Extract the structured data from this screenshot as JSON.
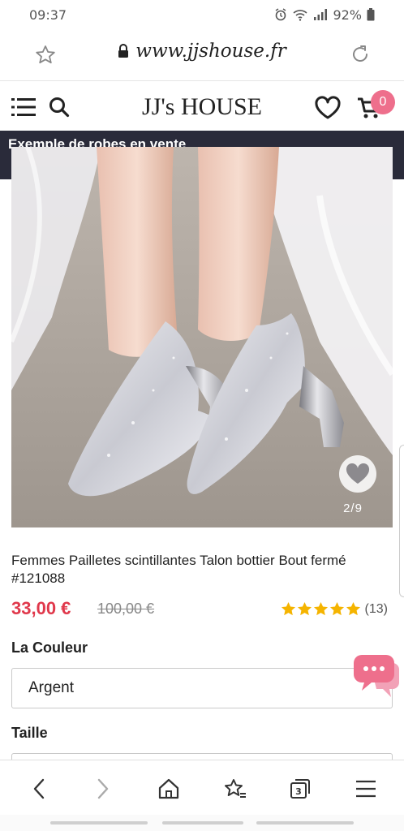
{
  "status_bar": {
    "time": "09:37",
    "battery": "92%"
  },
  "browser": {
    "url": "www.jjshouse.fr"
  },
  "header": {
    "brand": "JJ's HOUSE",
    "cart_count": "0"
  },
  "promo": {
    "text": "Exemple de robes en vente"
  },
  "gallery": {
    "counter": "2/9"
  },
  "product": {
    "title": "Femmes Pailletes scintillantes Talon bottier Bout fermé #121088",
    "price": "33,00 €",
    "old_price": "100,00 €",
    "rating_count": "(13)",
    "rating": 5,
    "rating_color": "#f5b400",
    "price_color": "#e0384b"
  },
  "options": {
    "color_label": "La Couleur",
    "color_value": "Argent",
    "size_label": "Taille"
  },
  "icons": {
    "menu": "hamburger-icon",
    "search": "search-icon",
    "wishlist": "heart-icon",
    "cart": "cart-icon",
    "chat": "chat-bubble-icon"
  },
  "accent_color": "#ee6f8c"
}
